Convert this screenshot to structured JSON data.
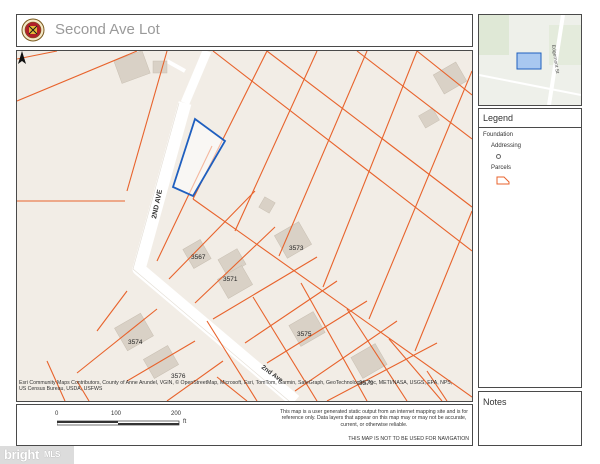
{
  "header": {
    "title": "Second Ave Lot"
  },
  "map": {
    "road_labels": {
      "second_ave_vertical": "2ND AVE",
      "second_ave_diagonal": "2nd Ave"
    },
    "addresses": [
      "3567",
      "3573",
      "3571",
      "3575",
      "3574",
      "3576",
      "3579"
    ],
    "attribution": "Esri Community Maps Contributors, County of Anne Arundel, VGIN, © OpenStreetMap, Microsoft, Esri, TomTom, Garmin, SafeGraph, GeoTechnologies, Inc, METI/NASA, USGS, EPA, NPS, US Census Bureau, USDA, USFWS",
    "colors": {
      "parcel": "#e8632c",
      "highlight": "#1f5fbf",
      "background": "#f2ede6",
      "road": "#ffffff",
      "building": "#d9d1c6"
    }
  },
  "scale": {
    "ticks": [
      "0",
      "100",
      "200"
    ],
    "unit": "ft",
    "disclaimer": "This map is a user generated static output from an internet mapping site and is for reference only. Data layers that appear on this map may or may not be accurate, current, or otherwise reliable.",
    "not_for_navigation": "THIS MAP IS NOT TO BE USED FOR NAVIGATION"
  },
  "overview": {
    "road_label": "Edgemont St"
  },
  "legend": {
    "title": "Legend",
    "group": "Foundation",
    "items": [
      {
        "label": "Addressing",
        "symbol": "dot"
      },
      {
        "label": "Parcels",
        "symbol": "parcel-outline"
      }
    ]
  },
  "notes": {
    "title": "Notes"
  },
  "watermark": {
    "brand": "bright",
    "suffix": "MLS"
  }
}
